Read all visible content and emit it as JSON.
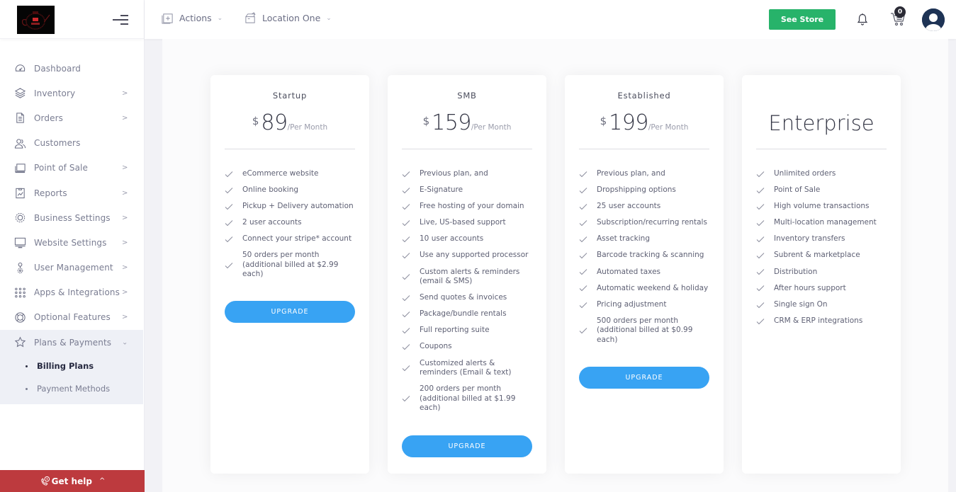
{
  "sidebar": {
    "items": [
      {
        "label": "Dashboard",
        "icon": "dashboard-icon",
        "has_children": false
      },
      {
        "label": "Inventory",
        "icon": "layers-icon",
        "has_children": true
      },
      {
        "label": "Orders",
        "icon": "document-icon",
        "has_children": true
      },
      {
        "label": "Customers",
        "icon": "users-icon",
        "has_children": false
      },
      {
        "label": "Point of Sale",
        "icon": "register-icon",
        "has_children": true
      },
      {
        "label": "Reports",
        "icon": "chart-clipboard-icon",
        "has_children": true
      },
      {
        "label": "Business Settings",
        "icon": "gear-icon",
        "has_children": true
      },
      {
        "label": "Website Settings",
        "icon": "monitor-icon",
        "has_children": true
      },
      {
        "label": "User Management",
        "icon": "user-cog-icon",
        "has_children": true
      },
      {
        "label": "Apps & Integrations",
        "icon": "grid-dots-icon",
        "has_children": true
      },
      {
        "label": "Optional Features",
        "icon": "lifebuoy-icon",
        "has_children": true
      },
      {
        "label": "Plans & Payments",
        "icon": "star-icon",
        "has_children": true,
        "expanded": true
      }
    ],
    "subitems": [
      {
        "label": "Billing Plans",
        "active": true
      },
      {
        "label": "Payment Methods",
        "active": false
      }
    ],
    "chevron_glyph": ">",
    "expanded_glyph": "⌄",
    "get_help": {
      "label": "Get help",
      "caret": "^"
    }
  },
  "header": {
    "actions_label": "Actions",
    "location_label": "Location One",
    "dropdown_caret": "⌄",
    "see_store_label": "See Store",
    "cart_count": "0"
  },
  "colors": {
    "accent_blue": "#38a3f3",
    "see_store_green": "#27b36a",
    "get_help_red": "#bd3a3e"
  },
  "plans": [
    {
      "name": "Startup",
      "currency": "$",
      "price": "89",
      "period": "/Per Month",
      "features": [
        "eCommerce website",
        "Online booking",
        "Pickup + Delivery automation",
        "2 user accounts",
        "Connect your stripe* account",
        "50 orders per month (additional billed at $2.99 each)"
      ],
      "button": "UPGRADE"
    },
    {
      "name": "SMB",
      "currency": "$",
      "price": "159",
      "period": "/Per Month",
      "features": [
        "Previous plan, and",
        "E-Signature",
        "Free hosting of your domain",
        "Live, US-based support",
        "10 user accounts",
        "Use any supported processor",
        "Custom alerts & reminders (email & SMS)",
        "Send quotes & invoices",
        "Package/bundle rentals",
        "Full reporting suite",
        "Coupons",
        "Customized alerts & reminders (Email & text)",
        "200 orders per month (additional billed at $1.99 each)"
      ],
      "button": "UPGRADE"
    },
    {
      "name": "Established",
      "currency": "$",
      "price": "199",
      "period": "/Per Month",
      "features": [
        "Previous plan, and",
        "Dropshipping options",
        "25 user accounts",
        "Subscription/recurring rentals",
        "Asset tracking",
        "Barcode tracking & scanning",
        "Automated taxes",
        "Automatic weekend & holiday",
        "Pricing adjustment",
        "500 orders per month (additional billed at $0.99 each)"
      ],
      "button": "UPGRADE"
    },
    {
      "name": "Enterprise",
      "features": [
        "Unlimited orders",
        "Point of Sale",
        "High volume transactions",
        "Multi-location management",
        "Inventory transfers",
        "Subrent & marketplace",
        "Distribution",
        "After hours support",
        "Single sign On",
        "CRM & ERP integrations"
      ]
    }
  ]
}
